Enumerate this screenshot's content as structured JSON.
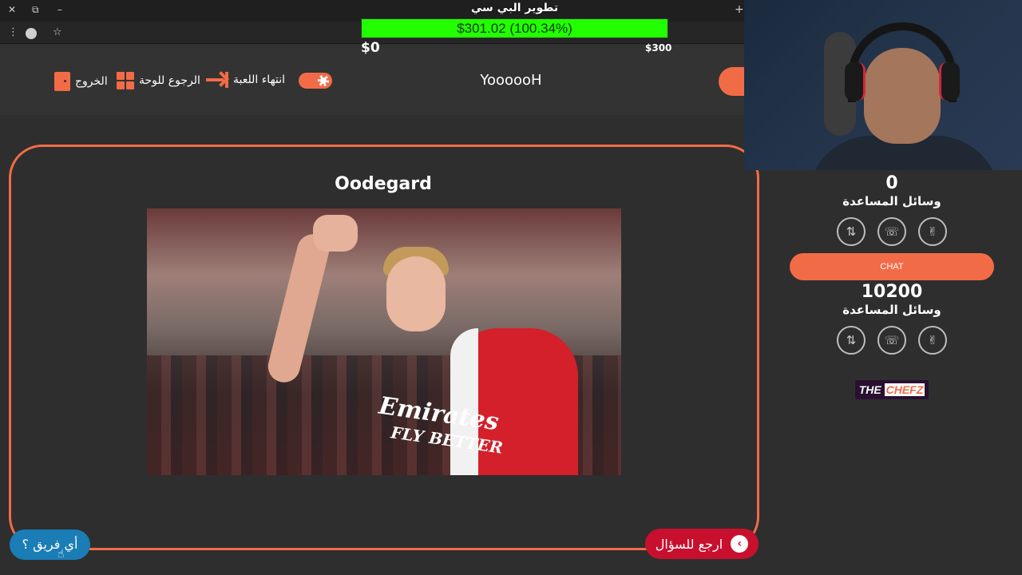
{
  "browser": {
    "close": "✕",
    "restore": "⧉",
    "minimize": "–",
    "new_tab": "+",
    "menu": "⋮",
    "star": "☆"
  },
  "donation": {
    "title": "تطوير البي سي",
    "amount_text": "$301.02 (100.34%)",
    "progress_percent": 100.34,
    "min_label": "$0",
    "max_label": "$300",
    "fill_color": "#21ff00"
  },
  "header": {
    "exit_label": "الخروج",
    "board_label": "الرجوع للوحة",
    "end_game_label": "انتهاء اللعبة",
    "team_name": "YoooooH",
    "accent": "#f26b47"
  },
  "main": {
    "player_name": "Oodegard",
    "photo_sponsor_1": "Emirates",
    "photo_sponsor_2": "FLY BETTER",
    "which_team_button": "أي فريق ؟",
    "back_to_question_button": "ارجع للسؤال"
  },
  "side": {
    "team1_score": "0",
    "team1_aids_label": "وسائل المساعدة",
    "chat_label": "CHAT",
    "team2_score": "10200",
    "team2_aids_label": "وسائل المساعدة",
    "logo_part1": "THE ",
    "logo_part2": "CHEFZ",
    "aid_icons": [
      "swap-icon",
      "phone-icon",
      "peace-hand-icon"
    ]
  }
}
